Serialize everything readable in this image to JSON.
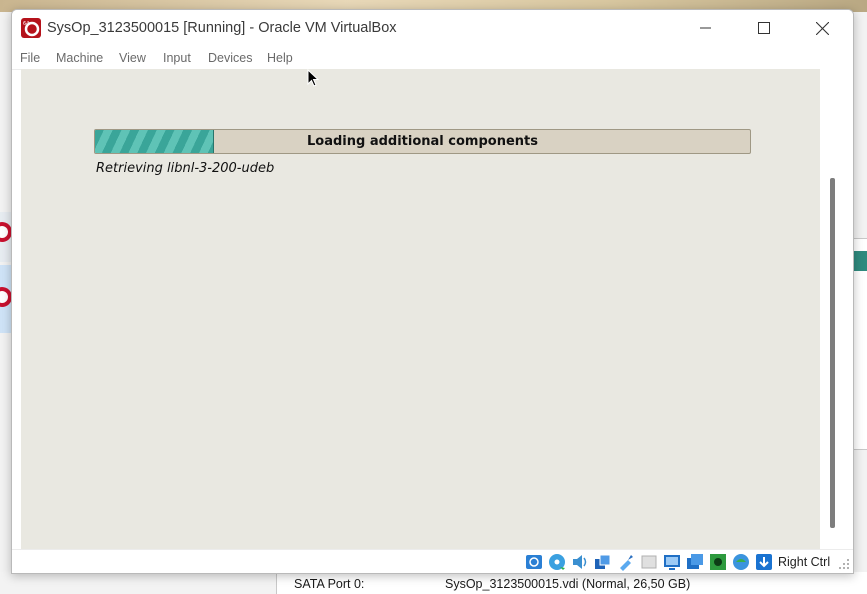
{
  "window": {
    "title": "SysOp_3123500015 [Running] - Oracle VM VirtualBox"
  },
  "menu": {
    "items": [
      "File",
      "Machine",
      "View",
      "Input",
      "Devices",
      "Help"
    ]
  },
  "guest": {
    "progress_label": "Loading additional components",
    "progress_fraction": 0.18,
    "status_text": "Retrieving libnl-3-200-udeb"
  },
  "statusbar": {
    "host_key": "Right Ctrl",
    "icons": [
      "hard-disk-icon",
      "optical-drive-icon",
      "audio-icon",
      "network-icon",
      "usb-icon",
      "shared-folders-icon",
      "display-icon",
      "video-capture-icon",
      "recording-icon",
      "cpu-icon",
      "mouse-integration-icon",
      "keyboard-capture-icon"
    ]
  },
  "background": {
    "storage_label": "SATA Port 0:",
    "storage_value": "SysOp_3123500015.vdi (Normal, 26,50 GB)"
  },
  "colors": {
    "guest_bg": "#e9e8e1",
    "progress_fill": "#3aa599",
    "progress_bg": "#d9d2c3"
  }
}
